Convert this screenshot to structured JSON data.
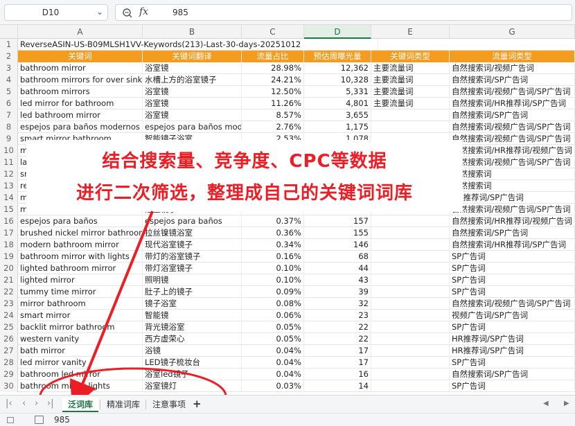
{
  "formula_bar": {
    "cell_ref": "D10",
    "fx_label": "fx",
    "value": "985"
  },
  "columns": [
    "A",
    "B",
    "C",
    "D",
    "E",
    "G"
  ],
  "active_column": "D",
  "title_row": "ReverseASIN-US-B09MLSH1VV-Keywords(213)-Last-30-days-20251012",
  "header_row": [
    "关键词",
    "关键词翻译",
    "流量占比",
    "预估周曝光量",
    "关键词类型",
    "流量词类型"
  ],
  "rows": [
    {
      "n": "3",
      "a": "bathroom mirror",
      "b": "浴室镜",
      "c": "28.98%",
      "d": "12,362",
      "e": "主要流量词",
      "f": "自然搜索词/视频广告词"
    },
    {
      "n": "4",
      "a": "bathroom mirrors for over sink",
      "b": "水槽上方的浴室镜子",
      "c": "24.21%",
      "d": "10,328",
      "e": "主要流量词",
      "f": "自然搜索词/SP广告词"
    },
    {
      "n": "5",
      "a": "bathroom mirrors",
      "b": "浴室镜",
      "c": "12.50%",
      "d": "5,331",
      "e": "主要流量词",
      "f": "自然搜索词/视频广告词/SP广告词"
    },
    {
      "n": "6",
      "a": "led mirror for bathroom",
      "b": "浴室镜",
      "c": "11.26%",
      "d": "4,801",
      "e": "主要流量词",
      "f": "自然搜索词/HR推荐词/SP广告词"
    },
    {
      "n": "7",
      "a": "led bathroom mirror",
      "b": "浴室镜",
      "c": "8.57%",
      "d": "3,655",
      "e": "",
      "f": "自然搜索词/SP广告词"
    },
    {
      "n": "8",
      "a": "espejos para baños modernos",
      "b": "espejos para baños mode",
      "c": "2.76%",
      "d": "1,175",
      "e": "",
      "f": "自然搜索词/视频广告词/SP广告词"
    },
    {
      "n": "9",
      "a": "smart mirror bathroom",
      "b": "智能镜子浴室",
      "c": "2.53%",
      "d": "1,078",
      "e": "",
      "f": "自然搜索词/视频广告词/SP广告词"
    },
    {
      "n": "10",
      "a": "mirror",
      "b": "",
      "c": "",
      "d": "",
      "e": "",
      "f": "自然搜索词/HR推荐词/视频广告词"
    },
    {
      "n": "11",
      "a": "large b",
      "b": "",
      "c": "",
      "d": "",
      "e": "",
      "f": "自然搜索词/视频广告词/SP广告词"
    },
    {
      "n": "12",
      "a": "smart b",
      "b": "",
      "c": "",
      "d": "",
      "e": "",
      "f": "自然搜索词"
    },
    {
      "n": "13",
      "a": "rectang",
      "b": "",
      "c": "",
      "d": "",
      "e": "",
      "f": "自然搜索词"
    },
    {
      "n": "14",
      "a": "mirrors",
      "b": "",
      "c": "",
      "d": "",
      "e": "",
      "f": "HR推荐词/SP广告词"
    },
    {
      "n": "15",
      "a": "mirrors for bathroom",
      "b": "浴室镜子",
      "c": "0.58%",
      "d": "249",
      "e": "",
      "f": "自然搜索词/视频广告词/SP广告词"
    },
    {
      "n": "16",
      "a": "espejos para baños",
      "b": "espejos para baños",
      "c": "0.37%",
      "d": "157",
      "e": "",
      "f": "自然搜索词/HR推荐词/视频广告词"
    },
    {
      "n": "17",
      "a": "brushed nickel mirror bathroom",
      "b": "拉丝镍镜浴室",
      "c": "0.36%",
      "d": "155",
      "e": "",
      "f": "自然搜索词/SP广告词"
    },
    {
      "n": "18",
      "a": "modern bathroom mirror",
      "b": "现代浴室镜子",
      "c": "0.34%",
      "d": "146",
      "e": "",
      "f": "自然搜索词/HR推荐词/SP广告词"
    },
    {
      "n": "19",
      "a": "bathroom mirror with lights",
      "b": "带灯的浴室镜子",
      "c": "0.16%",
      "d": "68",
      "e": "",
      "f": "SP广告词"
    },
    {
      "n": "20",
      "a": "lighted bathroom mirror",
      "b": "带灯浴室镜子",
      "c": "0.10%",
      "d": "44",
      "e": "",
      "f": "SP广告词"
    },
    {
      "n": "21",
      "a": "lighted mirror",
      "b": "照明镜",
      "c": "0.10%",
      "d": "43",
      "e": "",
      "f": "SP广告词"
    },
    {
      "n": "22",
      "a": "tummy time mirror",
      "b": "肚子上的镜子",
      "c": "0.09%",
      "d": "39",
      "e": "",
      "f": "SP广告词"
    },
    {
      "n": "23",
      "a": "mirror bathroom",
      "b": "镜子浴室",
      "c": "0.08%",
      "d": "32",
      "e": "",
      "f": "自然搜索词/视频广告词/SP广告词"
    },
    {
      "n": "24",
      "a": "smart mirror",
      "b": "智能镜",
      "c": "0.06%",
      "d": "23",
      "e": "",
      "f": "视频广告词/SP广告词"
    },
    {
      "n": "25",
      "a": "backlit mirror bathroom",
      "b": "背光镜浴室",
      "c": "0.05%",
      "d": "22",
      "e": "",
      "f": "SP广告词"
    },
    {
      "n": "26",
      "a": "western vanity",
      "b": "西方虚荣心",
      "c": "0.05%",
      "d": "22",
      "e": "",
      "f": "HR推荐词/SP广告词"
    },
    {
      "n": "27",
      "a": "bath mirror",
      "b": "浴镜",
      "c": "0.04%",
      "d": "17",
      "e": "",
      "f": "HR推荐词/SP广告词"
    },
    {
      "n": "28",
      "a": "led mirror vanity",
      "b": "LED镜子梳妆台",
      "c": "0.04%",
      "d": "17",
      "e": "",
      "f": "SP广告词"
    },
    {
      "n": "29",
      "a": "bathroom led mirror",
      "b": "浴室led镜子",
      "c": "0.04%",
      "d": "16",
      "e": "",
      "f": "自然搜索词/SP广告词"
    },
    {
      "n": "30",
      "a": "bathroom mirror lights",
      "b": "浴室镜灯",
      "c": "0.03%",
      "d": "14",
      "e": "",
      "f": "SP广告词"
    }
  ],
  "overlay": {
    "line1": "结合搜索量、竞争度、CPC等数据",
    "line2": "进行二次筛选，整理成自己的关键词词库",
    "text_color": "#ee1c24"
  },
  "sheet_tabs": [
    "泛词库",
    "精准词库",
    "注意事项"
  ],
  "active_tab": "泛词库",
  "add_sheet_label": "+",
  "status_bar": {
    "value": "985"
  },
  "colors": {
    "header_bg": "#f39c1f",
    "accent": "#217346",
    "annotation": "#ee1c24"
  }
}
